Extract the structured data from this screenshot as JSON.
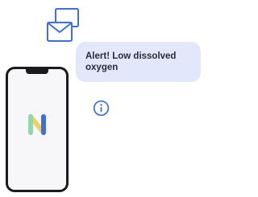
{
  "notification": {
    "message": "Alert! Low dissolved oxygen"
  },
  "colors": {
    "accent": "#3f6fd8",
    "bubble_bg": "#e3e7fa",
    "text": "#2a2b38",
    "logo_green": "#8ed9a8",
    "logo_yellow": "#f1d15a",
    "logo_blue": "#3f6fd8"
  },
  "icons": [
    "mail-icon",
    "info-icon",
    "app-logo-icon"
  ]
}
